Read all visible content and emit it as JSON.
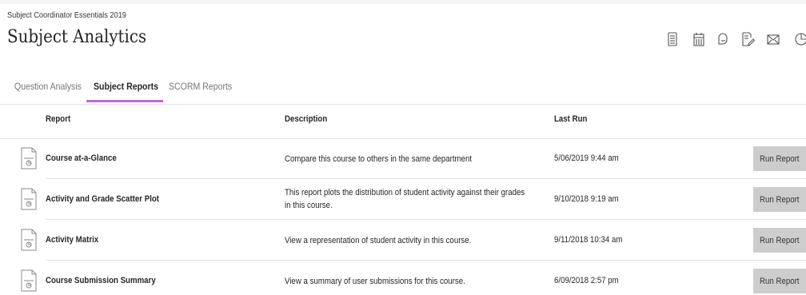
{
  "course_name": "Subject Coordinator Essentials 2019",
  "page_title": "Subject Analytics",
  "toolbar": {
    "icons": [
      "gradebook-icon",
      "calendar-icon",
      "discussion-icon",
      "edit-icon",
      "mail-icon",
      "analytics-icon"
    ]
  },
  "tabs": [
    {
      "label": "Question Analysis",
      "active": false
    },
    {
      "label": "Subject Reports",
      "active": true
    },
    {
      "label": "SCORM Reports",
      "active": false
    }
  ],
  "table": {
    "headers": {
      "report": "Report",
      "description": "Description",
      "last_run": "Last Run"
    },
    "rows": [
      {
        "name": "Course at-a-Glance",
        "description": "Compare this course to others in the same department",
        "last_run": "5/06/2019 9:44 am",
        "action": "Run Report"
      },
      {
        "name": "Activity and Grade Scatter Plot",
        "description": "This report plots the distribution of student activity against their grades in this course.",
        "last_run": "9/10/2018 9:19 am",
        "action": "Run Report"
      },
      {
        "name": "Activity Matrix",
        "description": "View a representation of student activity in this course.",
        "last_run": "9/11/2018 10:34 am",
        "action": "Run Report"
      },
      {
        "name": "Course Submission Summary",
        "description": "View a summary of user submissions for this course.",
        "last_run": "6/09/2018 2:57 pm",
        "action": "Run Report"
      }
    ]
  },
  "colors": {
    "tab_accent": "#c16bd1",
    "button_bg": "#cdcdcd"
  }
}
